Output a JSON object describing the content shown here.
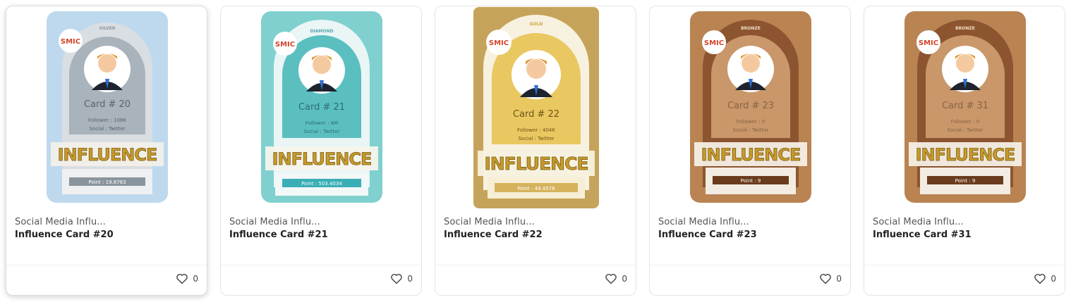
{
  "cards": [
    {
      "collection": "Social Media Influ...",
      "title": "Influence Card #20",
      "likes": "0",
      "art": {
        "tier": "SILVER",
        "brand": "SMIC",
        "card_label": "Card  # 20",
        "follower": "Follower : 108K",
        "social": "Social : Twitter",
        "word": "INFLUENCE",
        "point": "Point : 19.8783",
        "colors": {
          "bg": "#a9cde8",
          "arch": "#a9b3bb",
          "ribbon": "#8a949c",
          "frame": "#cfd6db"
        }
      }
    },
    {
      "collection": "Social Media Influ...",
      "title": "Influence Card #21",
      "likes": "0",
      "art": {
        "tier": "DIAMOND",
        "brand": "SMIC",
        "card_label": "Card  # 21",
        "follower": "Follower : 4M",
        "social": "Social : Twitter",
        "word": "INFLUENCE",
        "point": "Point : 503.4034",
        "colors": {
          "bg": "#7fd0cf",
          "arch": "#5bbfc0",
          "ribbon": "#3aaeb5",
          "frame": "#bde8e8"
        }
      }
    },
    {
      "collection": "Social Media Influ...",
      "title": "Influence Card #22",
      "likes": "0",
      "art": {
        "tier": "GOLD",
        "brand": "SMIC",
        "card_label": "Card  # 22",
        "follower": "Follower : 404K",
        "social": "Social : Twitter",
        "word": "INFLUENCE",
        "point": "Point : 49.4578",
        "colors": {
          "bg": "#c6a35a",
          "arch": "#e9c861",
          "ribbon": "#d5b35c",
          "frame": "#f4e4b0"
        }
      }
    },
    {
      "collection": "Social Media Influ...",
      "title": "Influence Card #23",
      "likes": "0",
      "art": {
        "tier": "BRONZE",
        "brand": "SMIC",
        "card_label": "Card  # 23",
        "follower": "Follower : 0",
        "social": "Social : Twitter",
        "word": "INFLUENCE",
        "point": "Point : 9",
        "colors": {
          "bg": "#b98352",
          "arch": "#c9976a",
          "ribbon": "#6b3b1d",
          "frame": "#8c5530"
        }
      }
    },
    {
      "collection": "Social Media Influ...",
      "title": "Influence Card #31",
      "likes": "0",
      "art": {
        "tier": "BRONZE",
        "brand": "SMIC",
        "card_label": "Card  # 31",
        "follower": "Follower : 0",
        "social": "Social : Twitter",
        "word": "INFLUENCE",
        "point": "Point : 9",
        "colors": {
          "bg": "#b98352",
          "arch": "#c9976a",
          "ribbon": "#6b3b1d",
          "frame": "#8c5530"
        }
      }
    }
  ]
}
